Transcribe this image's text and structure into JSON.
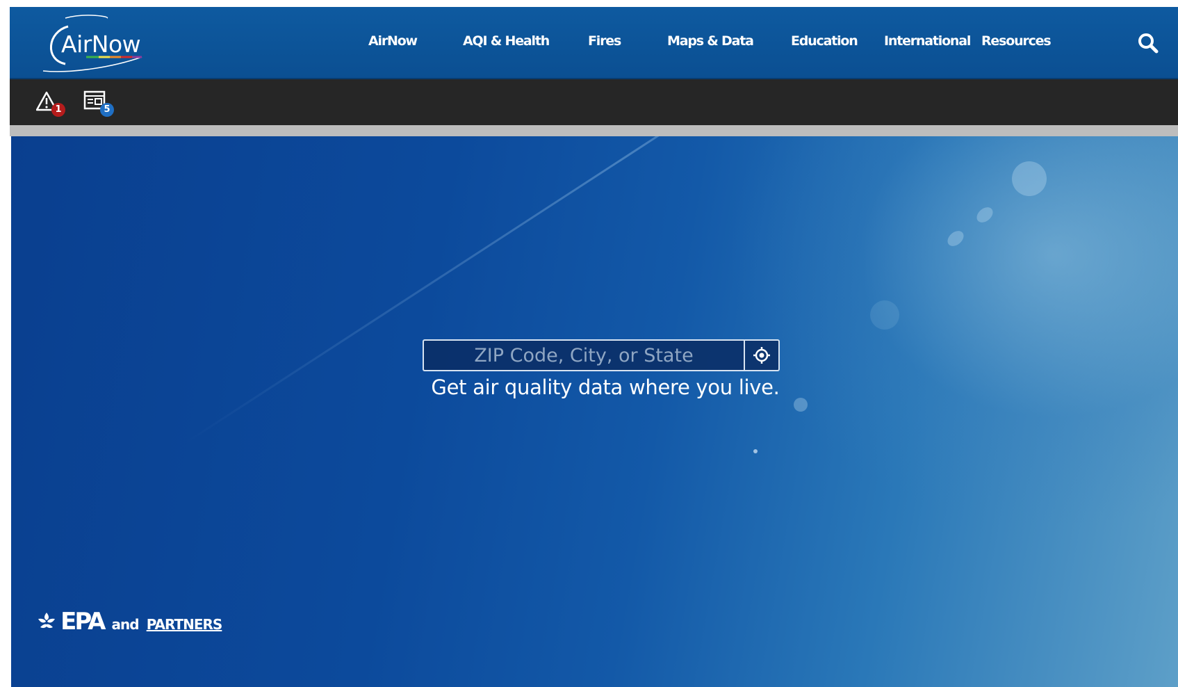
{
  "header": {
    "logo_text": "AirNow",
    "nav": [
      {
        "label": "AirNow"
      },
      {
        "label": "AQI & Health"
      },
      {
        "label": "Fires"
      },
      {
        "label": "Maps & Data"
      },
      {
        "label": "Education"
      },
      {
        "label": "International"
      },
      {
        "label": "Resources"
      }
    ],
    "search_icon": "search-icon"
  },
  "alerts": {
    "warning": {
      "icon": "warning-icon",
      "count": "1",
      "badge_color": "#b51c1c"
    },
    "notices": {
      "icon": "news-icon",
      "count": "5",
      "badge_color": "#1f6fc4"
    }
  },
  "hero": {
    "search_placeholder": "ZIP Code, City, or State",
    "locate_icon": "locate-icon",
    "tagline": "Get air quality data where you live."
  },
  "footer": {
    "epa": "EPA",
    "and": "and",
    "partners": "PARTNERS"
  },
  "colors": {
    "nav_bg": "#0e5aa0",
    "alert_bar_bg": "#262626",
    "hero_blue": "#0c4a9c"
  }
}
